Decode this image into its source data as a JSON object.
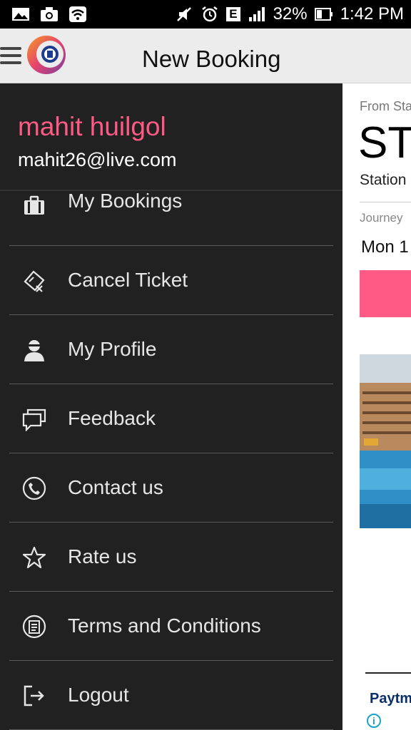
{
  "status_bar": {
    "battery": "32%",
    "time": "1:42 PM",
    "network": "E"
  },
  "app_bar": {
    "title": "New Booking"
  },
  "drawer": {
    "user_name": "mahit huilgol",
    "user_email": "mahit26@live.com",
    "items": [
      {
        "label": "My Bookings",
        "icon": "briefcase-icon"
      },
      {
        "label": "Cancel Ticket",
        "icon": "cancel-ticket-icon"
      },
      {
        "label": "My Profile",
        "icon": "profile-icon"
      },
      {
        "label": "Feedback",
        "icon": "feedback-icon"
      },
      {
        "label": "Contact us",
        "icon": "phone-icon"
      },
      {
        "label": "Rate us",
        "icon": "star-icon"
      },
      {
        "label": "Terms and Conditions",
        "icon": "terms-icon"
      },
      {
        "label": "Logout",
        "icon": "logout-icon"
      }
    ]
  },
  "content": {
    "from_label": "From Sta",
    "station_code": "ST",
    "station_label": "Station",
    "journey_label": "Journey",
    "journey_date": "Mon 1",
    "ad_brand": "Paytm"
  },
  "colors": {
    "accent": "#ff5a86",
    "drawer_bg": "#212121",
    "app_bar_bg": "#ececec"
  }
}
